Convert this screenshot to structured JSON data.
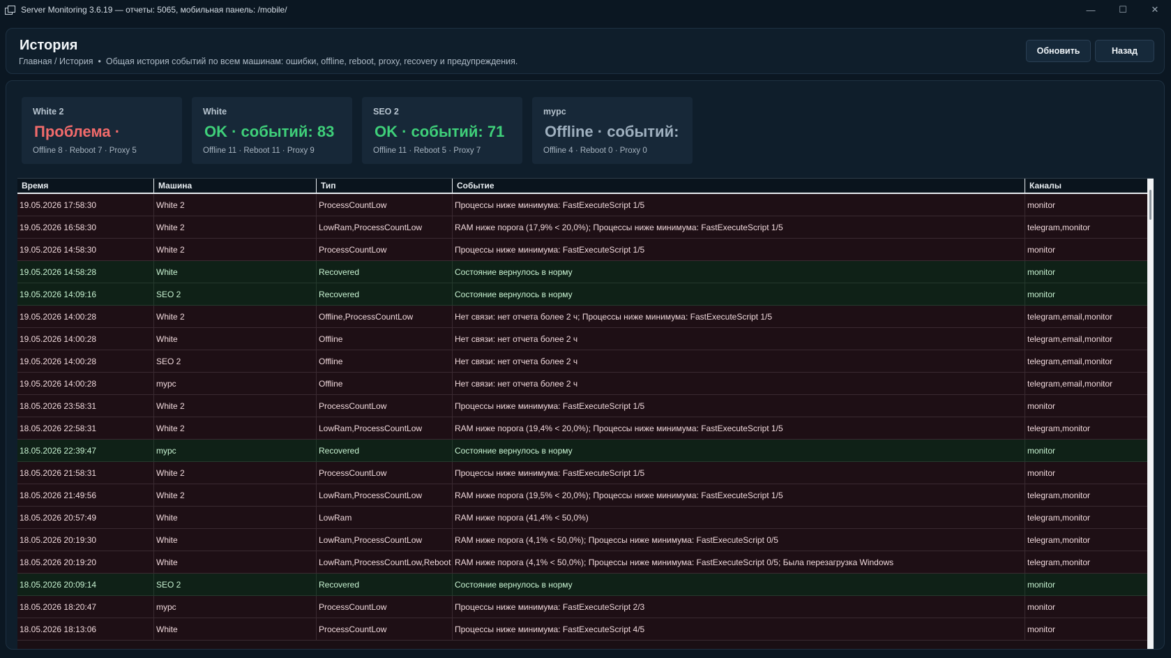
{
  "window": {
    "title": "Server Monitoring 3.6.19 — отчеты: 5065, мобильная панель: /mobile/"
  },
  "header": {
    "title": "История",
    "breadcrumb": "Главная / История",
    "separator": "•",
    "description": "Общая история событий по всем машинам: ошибки, offline, reboot, proxy, recovery и предупреждения.",
    "refresh_label": "Обновить",
    "back_label": "Назад"
  },
  "colors": {
    "problem": "#f26b6b",
    "ok": "#3fd07a",
    "offline": "#9fb0bf"
  },
  "cards": [
    {
      "name": "White 2",
      "status": "Проблема ·",
      "status_kind": "problem",
      "stats": "Offline 8 · Reboot 7 · Proxy 5"
    },
    {
      "name": "White",
      "status": "OK · событий: 83",
      "status_kind": "ok",
      "stats": "Offline 11 · Reboot 11 · Proxy 9"
    },
    {
      "name": "SEO 2",
      "status": "OK · событий: 71",
      "status_kind": "ok",
      "stats": "Offline 11 · Reboot 5 · Proxy 7"
    },
    {
      "name": "mypc",
      "status": "Offline · событий:",
      "status_kind": "offline",
      "stats": "Offline 4 · Reboot 0 · Proxy 0"
    }
  ],
  "table": {
    "columns": [
      "Время",
      "Машина",
      "Тип",
      "Событие",
      "Каналы"
    ],
    "rows": [
      {
        "time": "19.05.2026 17:58:30",
        "machine": "White 2",
        "type": "ProcessCountLow",
        "event": "Процессы ниже минимума: FastExecuteScript 1/5",
        "channels": "monitor",
        "kind": "problem"
      },
      {
        "time": "19.05.2026 16:58:30",
        "machine": "White 2",
        "type": "LowRam,ProcessCountLow",
        "event": "RAM ниже порога (17,9% < 20,0%); Процессы ниже минимума: FastExecuteScript 1/5",
        "channels": "telegram,monitor",
        "kind": "problem"
      },
      {
        "time": "19.05.2026 14:58:30",
        "machine": "White 2",
        "type": "ProcessCountLow",
        "event": "Процессы ниже минимума: FastExecuteScript 1/5",
        "channels": "monitor",
        "kind": "problem"
      },
      {
        "time": "19.05.2026 14:58:28",
        "machine": "White",
        "type": "Recovered",
        "event": "Состояние вернулось в норму",
        "channels": "monitor",
        "kind": "ok"
      },
      {
        "time": "19.05.2026 14:09:16",
        "machine": "SEO 2",
        "type": "Recovered",
        "event": "Состояние вернулось в норму",
        "channels": "monitor",
        "kind": "ok"
      },
      {
        "time": "19.05.2026 14:00:28",
        "machine": "White 2",
        "type": "Offline,ProcessCountLow",
        "event": "Нет связи: нет отчета более 2 ч; Процессы ниже минимума: FastExecuteScript 1/5",
        "channels": "telegram,email,monitor",
        "kind": "problem"
      },
      {
        "time": "19.05.2026 14:00:28",
        "machine": "White",
        "type": "Offline",
        "event": "Нет связи: нет отчета более 2 ч",
        "channels": "telegram,email,monitor",
        "kind": "problem"
      },
      {
        "time": "19.05.2026 14:00:28",
        "machine": "SEO 2",
        "type": "Offline",
        "event": "Нет связи: нет отчета более 2 ч",
        "channels": "telegram,email,monitor",
        "kind": "problem"
      },
      {
        "time": "19.05.2026 14:00:28",
        "machine": "mypc",
        "type": "Offline",
        "event": "Нет связи: нет отчета более 2 ч",
        "channels": "telegram,email,monitor",
        "kind": "problem"
      },
      {
        "time": "18.05.2026 23:58:31",
        "machine": "White 2",
        "type": "ProcessCountLow",
        "event": "Процессы ниже минимума: FastExecuteScript 1/5",
        "channels": "monitor",
        "kind": "problem"
      },
      {
        "time": "18.05.2026 22:58:31",
        "machine": "White 2",
        "type": "LowRam,ProcessCountLow",
        "event": "RAM ниже порога (19,4% < 20,0%); Процессы ниже минимума: FastExecuteScript 1/5",
        "channels": "telegram,monitor",
        "kind": "problem"
      },
      {
        "time": "18.05.2026 22:39:47",
        "machine": "mypc",
        "type": "Recovered",
        "event": "Состояние вернулось в норму",
        "channels": "monitor",
        "kind": "ok"
      },
      {
        "time": "18.05.2026 21:58:31",
        "machine": "White 2",
        "type": "ProcessCountLow",
        "event": "Процессы ниже минимума: FastExecuteScript 1/5",
        "channels": "monitor",
        "kind": "problem"
      },
      {
        "time": "18.05.2026 21:49:56",
        "machine": "White 2",
        "type": "LowRam,ProcessCountLow",
        "event": "RAM ниже порога (19,5% < 20,0%); Процессы ниже минимума: FastExecuteScript 1/5",
        "channels": "telegram,monitor",
        "kind": "problem"
      },
      {
        "time": "18.05.2026 20:57:49",
        "machine": "White",
        "type": "LowRam",
        "event": "RAM ниже порога (41,4% < 50,0%)",
        "channels": "telegram,monitor",
        "kind": "problem"
      },
      {
        "time": "18.05.2026 20:19:30",
        "machine": "White",
        "type": "LowRam,ProcessCountLow",
        "event": "RAM ниже порога (4,1% < 50,0%); Процессы ниже минимума: FastExecuteScript 0/5",
        "channels": "telegram,monitor",
        "kind": "problem"
      },
      {
        "time": "18.05.2026 20:19:20",
        "machine": "White",
        "type": "LowRam,ProcessCountLow,Reboot",
        "event": "RAM ниже порога (4,1% < 50,0%); Процессы ниже минимума: FastExecuteScript 0/5; Была перезагрузка Windows",
        "channels": "telegram,monitor",
        "kind": "problem"
      },
      {
        "time": "18.05.2026 20:09:14",
        "machine": "SEO 2",
        "type": "Recovered",
        "event": "Состояние вернулось в норму",
        "channels": "monitor",
        "kind": "ok"
      },
      {
        "time": "18.05.2026 18:20:47",
        "machine": "mypc",
        "type": "ProcessCountLow",
        "event": "Процессы ниже минимума: FastExecuteScript 2/3",
        "channels": "monitor",
        "kind": "problem"
      },
      {
        "time": "18.05.2026 18:13:06",
        "machine": "White",
        "type": "ProcessCountLow",
        "event": "Процессы ниже минимума: FastExecuteScript 4/5",
        "channels": "monitor",
        "kind": "problem"
      }
    ]
  }
}
